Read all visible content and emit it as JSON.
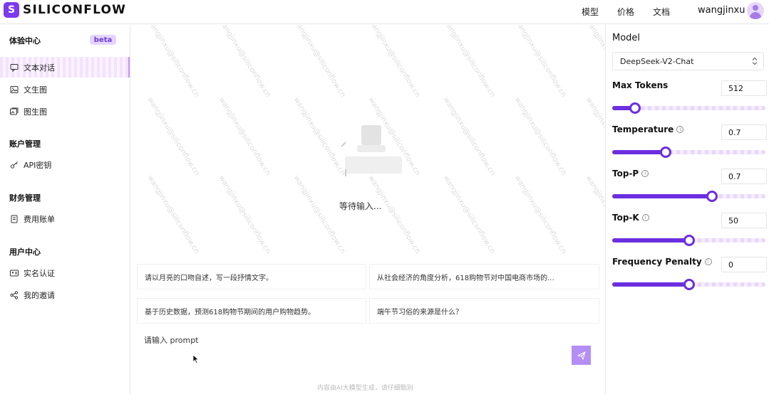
{
  "header": {
    "logo_glyph": "S",
    "logo_text": "SILICONFLOW",
    "nav": [
      "模型",
      "价格",
      "文档"
    ],
    "username": "wangjinxu"
  },
  "sidebar": {
    "sections": [
      {
        "title": "体验中心",
        "badge": "beta",
        "items": [
          {
            "label": "文本对话",
            "icon": "chat-icon",
            "active": true
          },
          {
            "label": "文生图",
            "icon": "image-icon",
            "active": false
          },
          {
            "label": "图生图",
            "icon": "images-icon",
            "active": false
          }
        ]
      },
      {
        "title": "账户管理",
        "items": [
          {
            "label": "API密钥",
            "icon": "key-icon",
            "active": false
          }
        ]
      },
      {
        "title": "财务管理",
        "items": [
          {
            "label": "费用账单",
            "icon": "bill-icon",
            "active": false
          }
        ]
      },
      {
        "title": "用户中心",
        "items": [
          {
            "label": "实名认证",
            "icon": "id-card-icon",
            "active": false
          },
          {
            "label": "我的邀请",
            "icon": "share-icon",
            "active": false
          }
        ]
      }
    ]
  },
  "main": {
    "watermark_text": "wangjinxu@siliconflow.cn",
    "empty_text": "等待输入...",
    "suggestions": [
      "请以月亮的口吻自述，写一段抒情文字。",
      "从社会经济的角度分析，618购物节对中国电商市场的...",
      "基于历史数据，预测618购物节期间的用户购物趋势。",
      "端午节习俗的来源是什么？"
    ],
    "prompt_placeholder": "请输入 prompt",
    "footer_note": "内容由AI大模型生成，请仔细甄别"
  },
  "settings": {
    "model_label": "Model",
    "model_value": "DeepSeek-V2-Chat",
    "params": [
      {
        "label": "Max Tokens",
        "value": "512",
        "info": false,
        "level": 0.15
      },
      {
        "label": "Temperature",
        "value": "0.7",
        "info": true,
        "level": 0.35
      },
      {
        "label": "Top-P",
        "value": "0.7",
        "info": true,
        "level": 0.65
      },
      {
        "label": "Top-K",
        "value": "50",
        "info": true,
        "level": 0.5
      },
      {
        "label": "Frequency Penalty",
        "value": "0",
        "info": true,
        "level": 0.5
      }
    ]
  },
  "colors": {
    "accent": "#6c2fe0",
    "accent_light": "#e8d7ff",
    "send_button": "#b48ef5"
  }
}
